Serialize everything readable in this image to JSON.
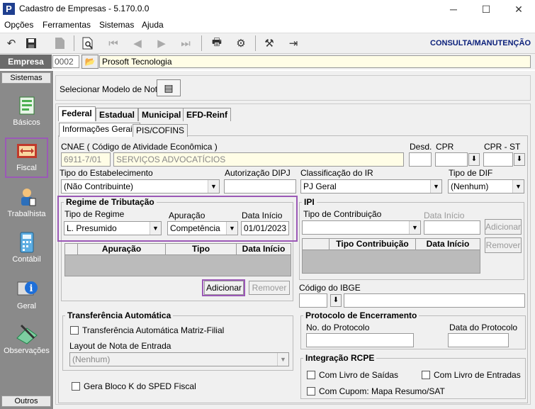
{
  "window": {
    "title": "Cadastro de Empresas - 5.170.0.0",
    "minimize": "─",
    "maximize": "☐",
    "close": "✕"
  },
  "menu": [
    "Opções",
    "Ferramentas",
    "Sistemas",
    "Ajuda"
  ],
  "toolbar": {
    "mode_label": "CONSULTA/MANUTENÇÃO",
    "icons": [
      "undo-icon",
      "save-icon",
      "delete-icon",
      "preview-icon",
      "first-record-icon",
      "previous-record-icon",
      "next-record-icon",
      "last-record-icon",
      "print-icon",
      "settings-icon",
      "tools-icon",
      "exit-icon"
    ]
  },
  "empresa": {
    "label": "Empresa",
    "code": "0002",
    "name": "Prosoft Tecnologia"
  },
  "sidebar": {
    "top_label": "Sistemas",
    "bottom_label": "Outros",
    "items": [
      {
        "label": "Básicos",
        "icon": "basicos-icon"
      },
      {
        "label": "Fiscal",
        "icon": "fiscal-icon"
      },
      {
        "label": "Trabalhista",
        "icon": "trabalhista-icon"
      },
      {
        "label": "Contábil",
        "icon": "calculator-icon"
      },
      {
        "label": "Geral",
        "icon": "info-icon"
      },
      {
        "label": "Observações",
        "icon": "notes-icon"
      }
    ]
  },
  "model": {
    "label": "Selecionar Modelo de Nota"
  },
  "tabs": [
    "Federal",
    "Estadual",
    "Municipal",
    "EFD-Reinf"
  ],
  "subtabs": [
    "Informações Gerais",
    "PIS/COFINS"
  ],
  "cnae": {
    "label": "CNAE ( Código de  Atividade Econômica )",
    "code": "6911-7/01",
    "description": "SERVIÇOS ADVOCATÍCIOS"
  },
  "desd": {
    "label": "Desd.",
    "value": ""
  },
  "cpr": {
    "label": "CPR",
    "value": ""
  },
  "cpr_st": {
    "label": "CPR - ST",
    "value": ""
  },
  "tipo_estabelecimento": {
    "label": "Tipo do Estabelecimento",
    "value": "(Não Contribuinte)"
  },
  "autorizacao": {
    "label": "Autorização DIPJ",
    "value": ""
  },
  "classificacao_ir": {
    "label": "Classificação do IR",
    "value": "PJ Geral"
  },
  "tipo_dif": {
    "label": "Tipo de DIF",
    "value": "(Nenhum)"
  },
  "regime": {
    "title": "Regime de Tributação",
    "tipo_label": "Tipo de Regime",
    "tipo_value": "L. Presumido",
    "apuracao_label": "Apuração",
    "apuracao_value": "Competência",
    "data_label": "Data Início",
    "data_value": "01/01/2023",
    "grid_columns": [
      "Apuração",
      "Tipo",
      "Data Início"
    ],
    "add_label": "Adicionar",
    "remove_label": "Remover"
  },
  "ipi": {
    "title": "IPI",
    "tipo_label": "Tipo de Contribuição",
    "tipo_value": "",
    "data_label": "Data Início",
    "data_value": "",
    "add_label": "Adicionar",
    "remove_label": "Remover",
    "grid_columns": [
      "Tipo Contribuição",
      "Data Início"
    ]
  },
  "ibge": {
    "label": "Código do IBGE",
    "code": "",
    "name": ""
  },
  "transferencia": {
    "title": "Transferência Automática",
    "check_label": "Transferência Automática Matriz-Filial",
    "layout_label": "Layout de Nota de Entrada",
    "layout_value": "(Nenhum)"
  },
  "bloco_k": {
    "label": "Gera Bloco K do SPED Fiscal"
  },
  "protocolo": {
    "title": "Protocolo de Encerramento",
    "numero_label": "No. do Protocolo",
    "numero_value": "",
    "data_label": "Data do Protocolo",
    "data_value": ""
  },
  "rcpe": {
    "title": "Integração RCPE",
    "saidas": "Com Livro de Saídas",
    "entradas": "Com Livro de Entradas",
    "cupom": "Com Cupom: Mapa Resumo/SAT"
  }
}
